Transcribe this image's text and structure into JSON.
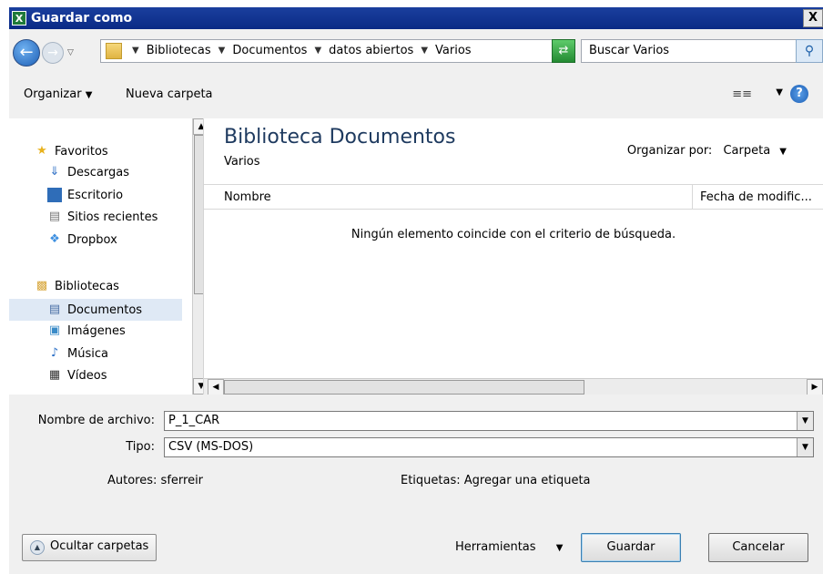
{
  "window": {
    "title": "Guardar como",
    "app_icon_text": "X",
    "close_label": "X"
  },
  "address": {
    "breadcrumbs": [
      "Bibliotecas",
      "Documentos",
      "datos abiertos",
      "Varios"
    ],
    "search_placeholder": "Buscar Varios"
  },
  "toolbar": {
    "organize_label": "Organizar",
    "new_folder_label": "Nueva carpeta"
  },
  "navpane": {
    "favorites_label": "Favoritos",
    "favorites": [
      "Descargas",
      "Escritorio",
      "Sitios recientes",
      "Dropbox"
    ],
    "libraries_label": "Bibliotecas",
    "libraries": [
      "Documentos",
      "Imágenes",
      "Música",
      "Vídeos"
    ],
    "selected": "Documentos"
  },
  "content": {
    "title": "Biblioteca Documentos",
    "subtitle": "Varios",
    "arrange_label": "Organizar por:",
    "arrange_value": "Carpeta",
    "columns": [
      "Nombre",
      "Fecha de modific..."
    ],
    "empty_message": "Ningún elemento coincide con el criterio de búsqueda."
  },
  "form": {
    "filename_label": "Nombre de archivo:",
    "filename_value": "P_1_CAR",
    "type_label": "Tipo:",
    "type_value": "CSV (MS-DOS)",
    "authors_label": "Autores:",
    "authors_value": "sferreir",
    "tags_label": "Etiquetas:",
    "tags_value": "Agregar una etiqueta"
  },
  "buttons": {
    "hide_folders": "Ocultar carpetas",
    "tools": "Herramientas",
    "save": "Guardar",
    "cancel": "Cancelar"
  },
  "colors": {
    "title_bar": "#0a2a85",
    "accent": "#1d5fb6",
    "selected": "#dfe9f5"
  }
}
